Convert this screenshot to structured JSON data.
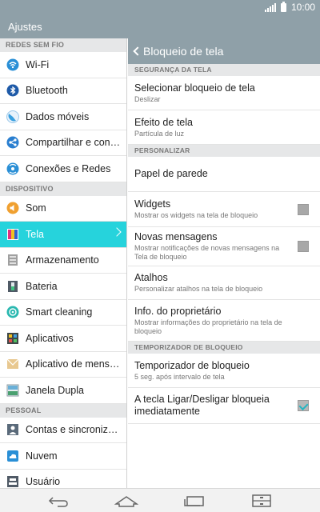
{
  "status": {
    "time": "10:00"
  },
  "app": {
    "title": "Ajustes"
  },
  "sidebar": {
    "sections": [
      {
        "header": "REDES SEM FIO",
        "items": [
          {
            "label": "Wi-Fi",
            "icon": "wifi-icon",
            "color": "#2a8fd6"
          },
          {
            "label": "Bluetooth",
            "icon": "bluetooth-icon",
            "color": "#1e5aa8"
          },
          {
            "label": "Dados móveis",
            "icon": "mobile-data-icon",
            "color": "#3aa0e0"
          },
          {
            "label": "Compartilhar e con…",
            "icon": "share-icon",
            "color": "#2a7fd0"
          },
          {
            "label": "Conexões e Redes",
            "icon": "networks-icon",
            "color": "#2a8fd6"
          }
        ]
      },
      {
        "header": "DISPOSITIVO",
        "items": [
          {
            "label": "Som",
            "icon": "sound-icon",
            "color": "#f0a030"
          },
          {
            "label": "Tela",
            "icon": "display-icon",
            "color": "#c050c0",
            "active": true
          },
          {
            "label": "Armazenamento",
            "icon": "storage-icon",
            "color": "#a0a0a0"
          },
          {
            "label": "Bateria",
            "icon": "battery-icon",
            "color": "#505a66"
          },
          {
            "label": "Smart cleaning",
            "icon": "smart-cleaning-icon",
            "color": "#2ab8b0"
          },
          {
            "label": "Aplicativos",
            "icon": "apps-icon",
            "color": "#404848"
          },
          {
            "label": "Aplicativo de mens…",
            "icon": "messaging-icon",
            "color": "#e8c890"
          },
          {
            "label": "Janela Dupla",
            "icon": "dual-window-icon",
            "color": "#4aa070"
          }
        ]
      },
      {
        "header": "PESSOAL",
        "items": [
          {
            "label": "Contas e sincroniza…",
            "icon": "accounts-icon",
            "color": "#5a6a7a"
          },
          {
            "label": "Nuvem",
            "icon": "cloud-icon",
            "color": "#2a8fd6"
          },
          {
            "label": "Usuário",
            "icon": "user-icon",
            "color": "#505a66"
          }
        ]
      }
    ]
  },
  "detail": {
    "title": "Bloqueio de tela",
    "sections": [
      {
        "header": "SEGURANÇA DA TELA",
        "items": [
          {
            "title": "Selecionar bloqueio de tela",
            "subtitle": "Deslizar"
          },
          {
            "title": "Efeito de tela",
            "subtitle": "Partícula de luz"
          }
        ]
      },
      {
        "header": "PERSONALIZAR",
        "items": [
          {
            "title": "Papel de parede",
            "subtitle": ""
          },
          {
            "title": "Widgets",
            "subtitle": "Mostrar os widgets na tela de bloqueio",
            "checkbox": false
          },
          {
            "title": "Novas mensagens",
            "subtitle": "Mostrar notificações de novas mensagens na Tela de bloqueio",
            "checkbox": false
          },
          {
            "title": "Atalhos",
            "subtitle": "Personalizar atalhos na tela de bloqueio"
          },
          {
            "title": "Info. do proprietário",
            "subtitle": "Mostrar informações do proprietário na tela de bloqueio"
          }
        ]
      },
      {
        "header": "TEMPORIZADOR DE BLOQUEIO",
        "items": [
          {
            "title": "Temporizador de bloqueio",
            "subtitle": "5 seg. após intervalo de tela"
          },
          {
            "title": "A tecla Ligar/Desligar bloqueia imediatamente",
            "subtitle": "",
            "checkbox": true
          }
        ]
      }
    ]
  },
  "navbar": {
    "buttons": [
      "back-icon",
      "home-icon",
      "recent-apps-icon",
      "menu-icon"
    ]
  }
}
